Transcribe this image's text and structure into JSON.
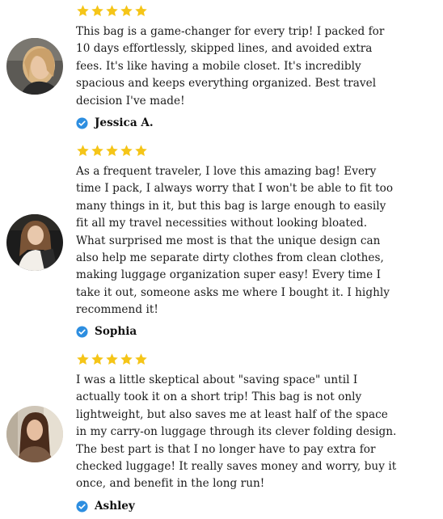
{
  "colors": {
    "star": "#f5c518",
    "verified": "#2d8ee0",
    "text": "#1a1a1a"
  },
  "icons": {
    "rating": "star-icon",
    "verified": "verified-check-icon"
  },
  "reviews": [
    {
      "rating": 5,
      "author": "Jessica A.",
      "lines": [
        "This bag is a game-changer for every trip! I packed for",
        "10 days effortlessly, skipped lines, and avoided extra",
        "fees. It's like having a mobile closet. It's incredibly",
        "spacious and keeps everything organized. Best travel",
        "decision I've made!"
      ]
    },
    {
      "rating": 5,
      "author": "Sophia",
      "lines": [
        "As a frequent traveler, I love this amazing bag! Every",
        "time I pack, I always worry that I won't be able to fit too",
        "many things in it, but this bag is large enough to easily",
        "fit all my travel necessities without looking bloated.",
        "What surprised me most is that the unique design can",
        "also help me separate dirty clothes from clean clothes,",
        "making luggage organization super easy! Every time I",
        "take it out, someone asks me where I bought it. I highly",
        "recommend it!"
      ]
    },
    {
      "rating": 5,
      "author": "Ashley",
      "lines": [
        "I was a little skeptical about \"saving space\" until I",
        "actually took it on a short trip! This bag is not only",
        "lightweight, but also saves me at least half of the space",
        "in my carry-on luggage through its clever folding design.",
        "The best part is that I no longer have to pay extra for",
        "checked luggage! It really saves money and worry, buy it",
        "once, and benefit in the long run!"
      ]
    }
  ]
}
